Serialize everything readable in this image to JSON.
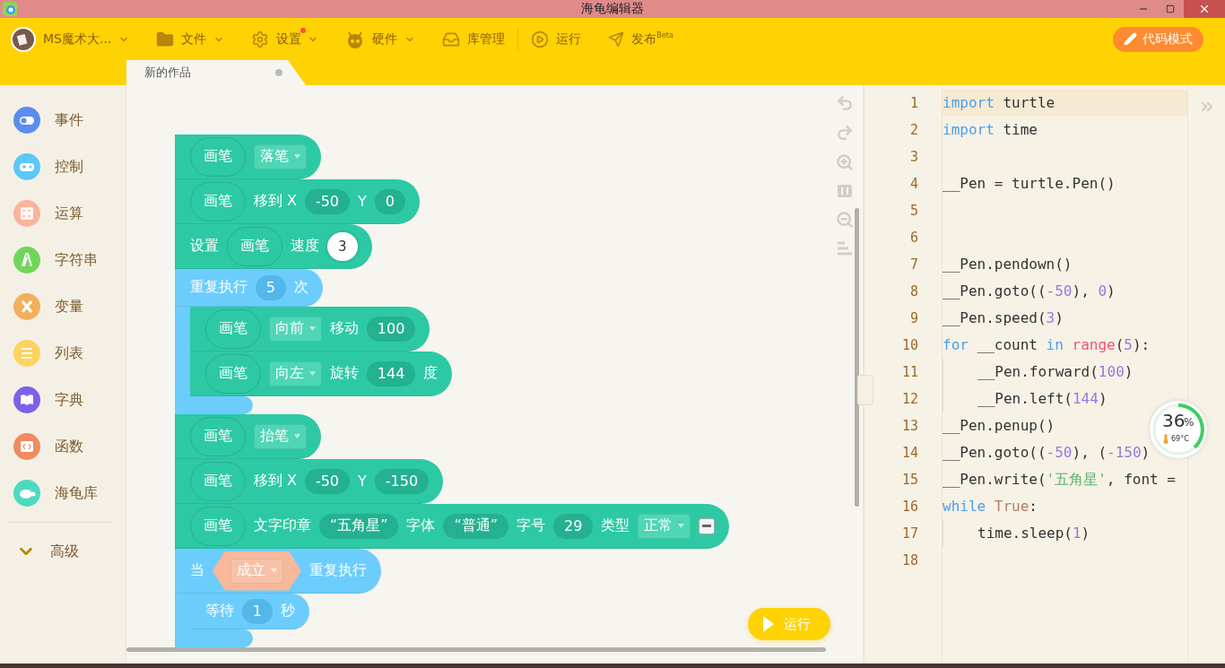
{
  "window": {
    "title": "海龟编辑器"
  },
  "toolbar": {
    "items": [
      {
        "label": "MS魔术大...",
        "has_menu": true,
        "badge": false
      },
      {
        "label": "文件",
        "has_menu": true,
        "badge": false
      },
      {
        "label": "设置",
        "has_menu": true,
        "badge": true
      },
      {
        "label": "硬件",
        "has_menu": true,
        "badge": false
      },
      {
        "label": "库管理",
        "has_menu": false,
        "badge": false
      },
      {
        "label": "运行",
        "has_menu": false,
        "badge": false
      },
      {
        "label": "发布$^{Beta}$",
        "has_menu": false,
        "badge": false
      }
    ],
    "mode_button": "代码模式"
  },
  "tabs": [
    {
      "label": "新的作品",
      "selected": true
    }
  ],
  "sidebar": {
    "items": [
      {
        "label": "事件",
        "color": "#5b8cf0"
      },
      {
        "label": "控制",
        "color": "#5cc8f7"
      },
      {
        "label": "运算",
        "color": "#f8b49c"
      },
      {
        "label": "字符串",
        "color": "#6fd65b"
      },
      {
        "label": "变量",
        "color": "#f2b05c"
      },
      {
        "label": "列表",
        "color": "#fdd25e"
      },
      {
        "label": "字典",
        "color": "#7c61e8"
      },
      {
        "label": "函数",
        "color": "#f08a60"
      },
      {
        "label": "海龟库",
        "color": "#4ddbc0"
      }
    ],
    "more": {
      "label": "高级",
      "expanded": false
    }
  },
  "blocks": [
    {
      "kind": "pen",
      "parts": [
        {
          "kind": "reporter",
          "text": "画笔"
        },
        {
          "kind": "dropdown",
          "text": "落笔"
        }
      ]
    },
    {
      "kind": "pen",
      "parts": [
        {
          "kind": "reporter",
          "text": "画笔"
        },
        {
          "kind": "label",
          "text": "移到 X"
        },
        {
          "kind": "number",
          "text": "-50"
        },
        {
          "kind": "label",
          "text": "Y"
        },
        {
          "kind": "number",
          "text": "0"
        }
      ]
    },
    {
      "kind": "pen",
      "parts": [
        {
          "kind": "label",
          "text": "设置"
        },
        {
          "kind": "reporter",
          "text": "画笔"
        },
        {
          "kind": "label",
          "text": "速度"
        },
        {
          "kind": "input",
          "text": "3"
        }
      ]
    },
    {
      "kind": "control",
      "parts": [
        {
          "kind": "label",
          "text": "重复执行"
        },
        {
          "kind": "number",
          "text": "5"
        },
        {
          "kind": "label",
          "text": "次"
        }
      ],
      "children": [
        {
          "kind": "pen",
          "parts": [
            {
              "kind": "reporter",
              "text": "画笔"
            },
            {
              "kind": "dropdown",
              "text": "向前"
            },
            {
              "kind": "label",
              "text": "移动"
            },
            {
              "kind": "number",
              "text": "100"
            }
          ]
        },
        {
          "kind": "pen",
          "parts": [
            {
              "kind": "reporter",
              "text": "画笔"
            },
            {
              "kind": "dropdown",
              "text": "向左"
            },
            {
              "kind": "label",
              "text": "旋转"
            },
            {
              "kind": "number",
              "text": "144"
            },
            {
              "kind": "label",
              "text": "度"
            }
          ]
        }
      ]
    },
    {
      "kind": "pen",
      "parts": [
        {
          "kind": "reporter",
          "text": "画笔"
        },
        {
          "kind": "dropdown",
          "text": "抬笔"
        }
      ]
    },
    {
      "kind": "pen",
      "parts": [
        {
          "kind": "reporter",
          "text": "画笔"
        },
        {
          "kind": "label",
          "text": "移到 X"
        },
        {
          "kind": "number",
          "text": "-50"
        },
        {
          "kind": "label",
          "text": "Y"
        },
        {
          "kind": "number",
          "text": "-150"
        }
      ]
    },
    {
      "kind": "pen",
      "parts": [
        {
          "kind": "reporter",
          "text": "画笔"
        },
        {
          "kind": "label",
          "text": "文字印章"
        },
        {
          "kind": "number",
          "text": "“五角星”"
        },
        {
          "kind": "label",
          "text": "字体"
        },
        {
          "kind": "number",
          "text": "“普通”"
        },
        {
          "kind": "label",
          "text": "字号"
        },
        {
          "kind": "number",
          "text": "29"
        },
        {
          "kind": "label",
          "text": "类型"
        },
        {
          "kind": "dropdown",
          "text": "正常"
        },
        {
          "kind": "minus"
        }
      ]
    },
    {
      "kind": "control",
      "parts": [
        {
          "kind": "label",
          "text": "当"
        },
        {
          "kind": "bool",
          "text": "成立"
        },
        {
          "kind": "label",
          "text": "重复执行"
        }
      ],
      "children": [
        {
          "kind": "control",
          "parts": [
            {
              "kind": "label",
              "text": "等待"
            },
            {
              "kind": "number",
              "text": "1"
            },
            {
              "kind": "label",
              "text": "秒"
            }
          ]
        }
      ]
    }
  ],
  "run_button": "运行",
  "code": {
    "lines": [
      {
        "number": "1",
        "current": true,
        "indented": false,
        "tokens": [
          {
            "t": "import ",
            "kind": "kw"
          },
          {
            "t": "turtle",
            "kind": "plain"
          }
        ]
      },
      {
        "number": "2",
        "current": false,
        "indented": false,
        "tokens": [
          {
            "t": "import ",
            "kind": "kw"
          },
          {
            "t": "time",
            "kind": "plain"
          }
        ]
      },
      {
        "number": "3",
        "current": false,
        "indented": false
      },
      {
        "number": "4",
        "current": false,
        "indented": false,
        "tokens": [
          {
            "t": "__Pen = turtle.Pen()",
            "kind": "plain"
          }
        ]
      },
      {
        "number": "5",
        "current": false,
        "indented": false
      },
      {
        "number": "6",
        "current": false,
        "indented": false
      },
      {
        "number": "7",
        "current": false,
        "indented": false,
        "tokens": [
          {
            "t": "__Pen.pendown()",
            "kind": "plain"
          }
        ]
      },
      {
        "number": "8",
        "current": false,
        "indented": false,
        "tokens": [
          {
            "t": "__Pen.goto((",
            "kind": "plain"
          },
          {
            "t": "-50",
            "kind": "num"
          },
          {
            "t": "), ",
            "kind": "plain"
          },
          {
            "t": "0",
            "kind": "num"
          },
          {
            "t": ")",
            "kind": "plain"
          }
        ]
      },
      {
        "number": "9",
        "current": false,
        "indented": false,
        "tokens": [
          {
            "t": "__Pen.speed(",
            "kind": "plain"
          },
          {
            "t": "3",
            "kind": "num"
          },
          {
            "t": ")",
            "kind": "plain"
          }
        ]
      },
      {
        "number": "10",
        "current": false,
        "indented": false,
        "tokens": [
          {
            "t": "for",
            "kind": "kw"
          },
          {
            "t": " __count ",
            "kind": "plain"
          },
          {
            "t": "in ",
            "kind": "kw"
          },
          {
            "t": "range",
            "kind": "builtin"
          },
          {
            "t": "(",
            "kind": "plain"
          },
          {
            "t": "5",
            "kind": "num"
          },
          {
            "t": "):",
            "kind": "plain"
          }
        ]
      },
      {
        "number": "11",
        "current": false,
        "indented": true,
        "tokens": [
          {
            "t": "__Pen.forward(",
            "kind": "plain"
          },
          {
            "t": "100",
            "kind": "num"
          },
          {
            "t": ")",
            "kind": "plain"
          }
        ]
      },
      {
        "number": "12",
        "current": false,
        "indented": true,
        "tokens": [
          {
            "t": "__Pen.left(",
            "kind": "plain"
          },
          {
            "t": "144",
            "kind": "num"
          },
          {
            "t": ")",
            "kind": "plain"
          }
        ]
      },
      {
        "number": "13",
        "current": false,
        "indented": false,
        "tokens": [
          {
            "t": "__Pen.penup()",
            "kind": "plain"
          }
        ]
      },
      {
        "number": "14",
        "current": false,
        "indented": false,
        "tokens": [
          {
            "t": "__Pen.goto((",
            "kind": "plain"
          },
          {
            "t": "-50",
            "kind": "num"
          },
          {
            "t": "), (",
            "kind": "plain"
          },
          {
            "t": "-150",
            "kind": "num"
          },
          {
            "t": ")",
            "kind": "plain"
          }
        ]
      },
      {
        "number": "15",
        "current": false,
        "indented": false,
        "tokens": [
          {
            "t": "__Pen.write(",
            "kind": "plain"
          },
          {
            "t": "'五角星'",
            "kind": "str"
          },
          {
            "t": ", font =",
            "kind": "plain"
          }
        ]
      },
      {
        "number": "16",
        "current": false,
        "indented": false,
        "tokens": [
          {
            "t": "while ",
            "kind": "kw"
          },
          {
            "t": "True",
            "kind": "const"
          },
          {
            "t": ":",
            "kind": "plain"
          }
        ]
      },
      {
        "number": "17",
        "current": false,
        "indented": true,
        "tokens": [
          {
            "t": "time.sleep(",
            "kind": "plain"
          },
          {
            "t": "1",
            "kind": "num"
          },
          {
            "t": ")",
            "kind": "plain"
          }
        ]
      },
      {
        "number": "18",
        "current": false,
        "indented": false
      }
    ]
  },
  "monitor": {
    "value": "36",
    "unit": "%",
    "temperature": "69°C"
  }
}
